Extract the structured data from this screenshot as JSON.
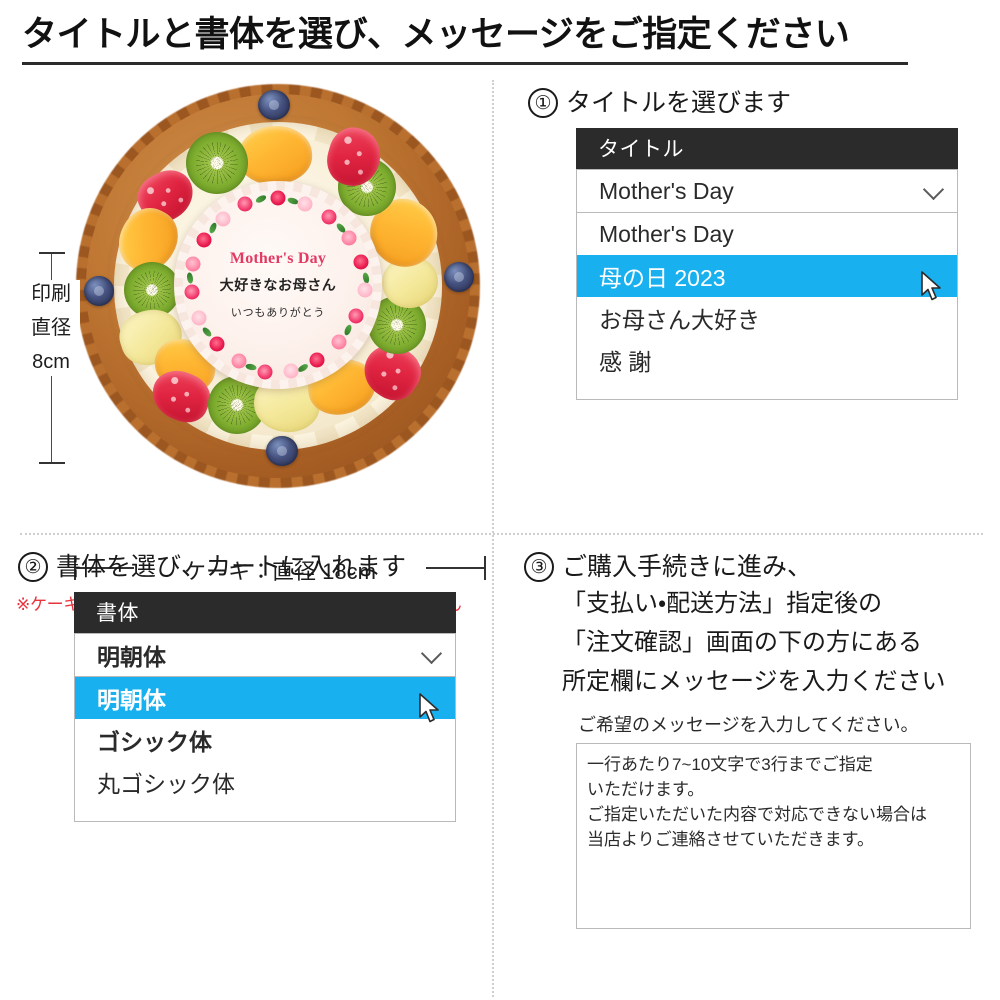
{
  "header": {
    "title": "タイトルと書体を選び、メッセージをご指定ください"
  },
  "cake": {
    "plate": {
      "title_en": "Mother's Day",
      "line_main": "大好きなお母さん",
      "line_sub": "いつもありがとう"
    },
    "print_dimension": {
      "label_1": "印刷",
      "label_2": "直径",
      "label_3": "8cm"
    },
    "cake_dimension": {
      "text": "ケーキ：直径 18cm"
    },
    "note": "※ケーキサイズが変わっても印刷面の大きさは変わりません"
  },
  "step1": {
    "number": "①",
    "title": "タイトルを選びます",
    "dropdown": {
      "header": "タイトル",
      "selected": "Mother's Day",
      "chevron_icon": "chevron-down-icon",
      "options": [
        {
          "label": "Mother's Day",
          "selected": false
        },
        {
          "label": "母の日 2023",
          "selected": true
        },
        {
          "label": "お母さん大好き",
          "selected": false
        },
        {
          "label": "感 謝",
          "selected": false
        }
      ]
    }
  },
  "step2": {
    "number": "②",
    "title": "書体を選び、カートに入れます",
    "dropdown": {
      "header": "書体",
      "selected": "明朝体",
      "chevron_icon": "chevron-down-icon",
      "options": [
        {
          "label": "明朝体",
          "selected": true,
          "style": "fs-mincho"
        },
        {
          "label": "ゴシック体",
          "selected": false,
          "style": "fs-gothic"
        },
        {
          "label": "丸ゴシック体",
          "selected": false,
          "style": "fs-maru"
        }
      ]
    }
  },
  "step3": {
    "number": "③",
    "lines": [
      "ご購入手続きに進み、",
      "「支払い・配送方法」指定後の",
      "「注文確認」画面の下の方にある",
      "所定欄にメッセージを入力ください"
    ],
    "message_label": "ご希望のメッセージを入力してください。",
    "message_value": "一行あたり7~10文字で3行までご指定\nいただけます。\nご指定いただいた内容で対応できない場合は\n当店よりご連絡させていただきます。"
  },
  "colors": {
    "highlight": "#19b0ef",
    "dropdown_header": "#2b2b2b",
    "note_red": "#e8323c",
    "plate_title": "#e23a63"
  }
}
